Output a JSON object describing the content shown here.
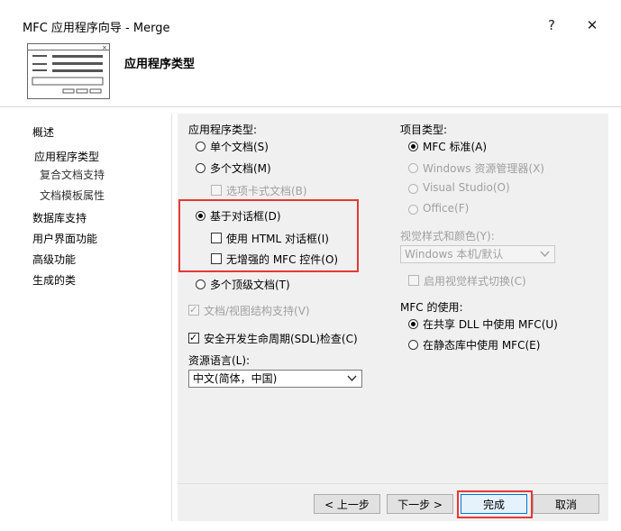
{
  "window": {
    "title": "MFC 应用程序向导 - Merge",
    "help_label": "?",
    "close_label": "✕"
  },
  "header": {
    "title": "应用程序类型"
  },
  "nav": {
    "items": [
      {
        "label": "概述"
      },
      {
        "label": "应用程序类型"
      },
      {
        "label": "复合文档支持"
      },
      {
        "label": "文档模板属性"
      },
      {
        "label": "数据库支持"
      },
      {
        "label": "用户界面功能"
      },
      {
        "label": "高级功能"
      },
      {
        "label": "生成的类"
      }
    ]
  },
  "app_type": {
    "group_label": "应用程序类型:",
    "single_doc": "单个文档(S)",
    "multi_doc": "多个文档(M)",
    "tabbed_docs": "选项卡式文档(B)",
    "dialog_based": "基于对话框(D)",
    "use_html_dialog": "使用 HTML 对话框(I)",
    "no_enhanced_mfc": "无增强的 MFC 控件(O)",
    "multi_toplevel": "多个顶级文档(T)",
    "doc_view_support": "文档/视图结构支持(V)",
    "sdl_check": "安全开发生命周期(SDL)检查(C)",
    "resource_lang_label": "资源语言(L):",
    "resource_lang_value": "中文(简体，中国)"
  },
  "project_type": {
    "group_label": "项目类型:",
    "mfc_standard": "MFC 标准(A)",
    "windows_explorer": "Windows 资源管理器(X)",
    "visual_studio": "Visual Studio(O)",
    "office": "Office(F)"
  },
  "visual_style": {
    "label": "视觉样式和颜色(Y):",
    "value": "Windows 本机/默认",
    "enable_switch": "启用视觉样式切换(C)"
  },
  "mfc_usage": {
    "label": "MFC 的使用:",
    "shared_dll": "在共享 DLL 中使用 MFC(U)",
    "static_lib": "在静态库中使用 MFC(E)"
  },
  "buttons": {
    "prev": "< 上一步",
    "next": "下一步 >",
    "finish": "完成",
    "cancel": "取消"
  },
  "colors": {
    "highlight_border": "#e53935",
    "panel_background": "#f0f0f0"
  }
}
